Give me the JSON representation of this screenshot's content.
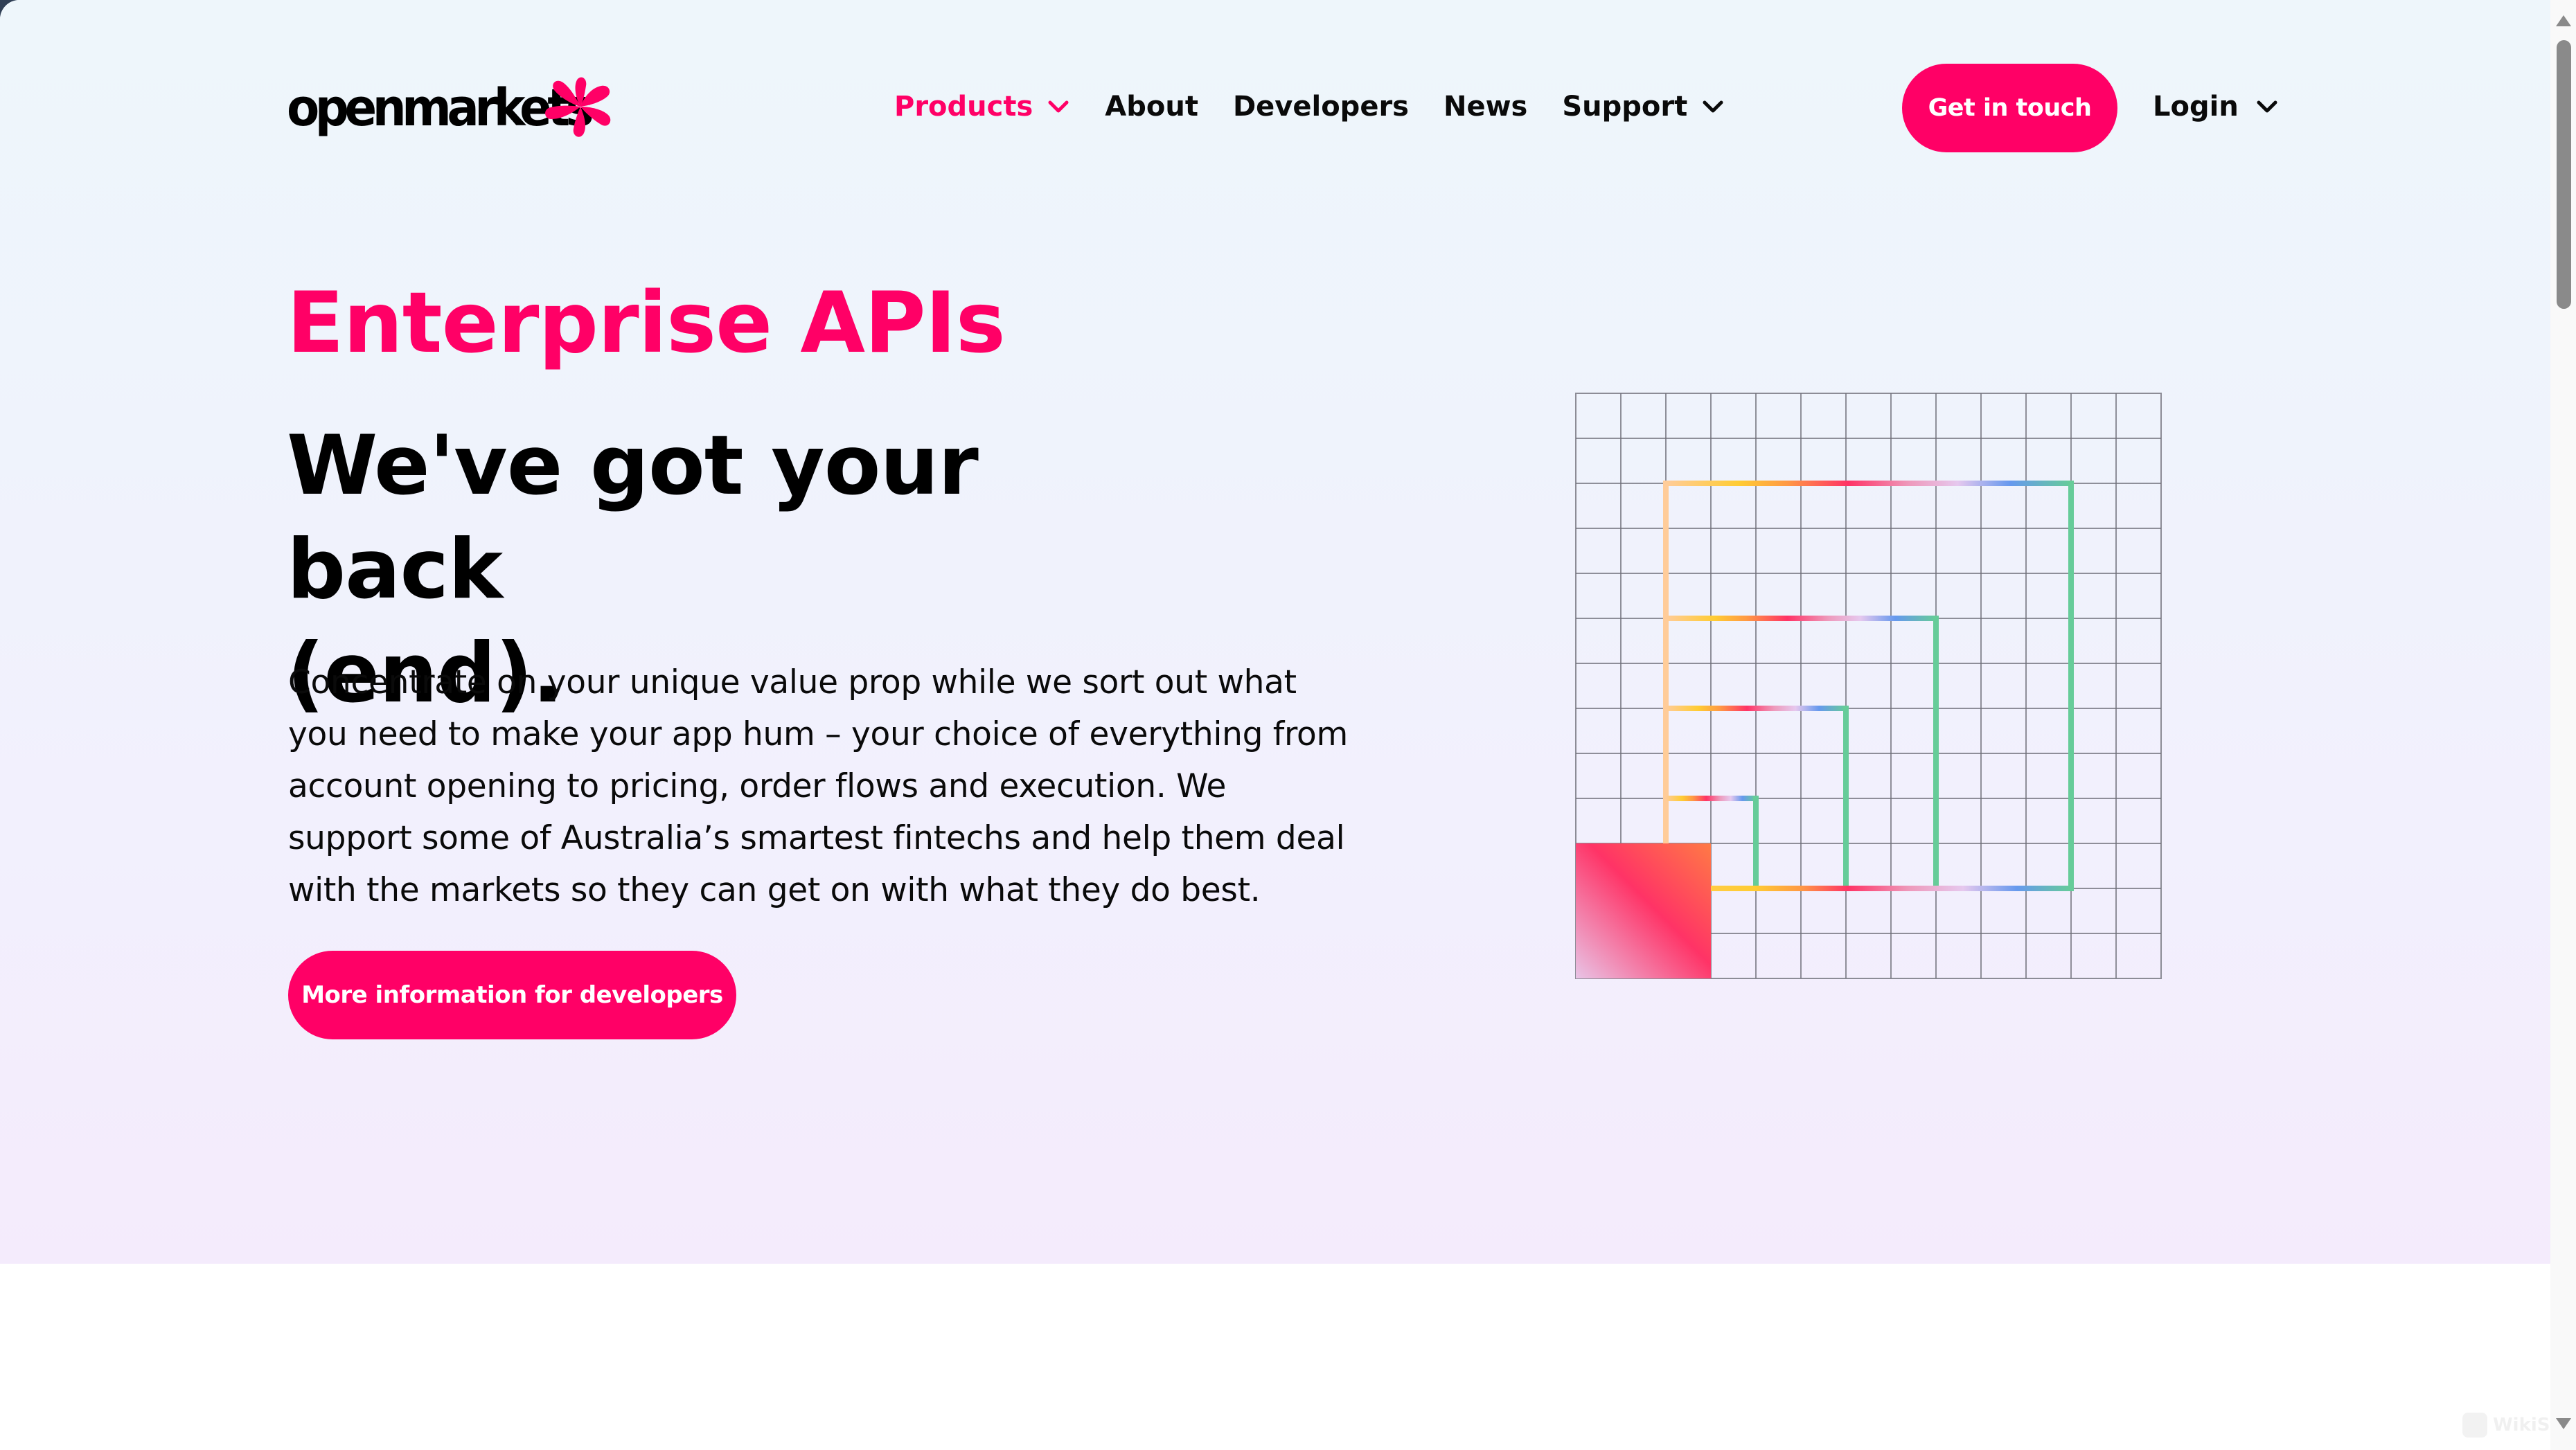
{
  "brand": {
    "name": "openmarkets",
    "accent_color": "#ff0066",
    "text_color": "#0a0a0a"
  },
  "nav": {
    "items": [
      {
        "label": "Products",
        "has_dropdown": true,
        "active": true
      },
      {
        "label": "About",
        "has_dropdown": false,
        "active": false
      },
      {
        "label": "Developers",
        "has_dropdown": false,
        "active": false
      },
      {
        "label": "News",
        "has_dropdown": false,
        "active": false
      },
      {
        "label": "Support",
        "has_dropdown": true,
        "active": false
      }
    ],
    "cta_label": "Get in touch",
    "login_label": "Login"
  },
  "hero": {
    "eyebrow": "Enterprise APIs",
    "headline_line1": "We've got your back",
    "headline_line2": "(end).",
    "body": "Concentrate on your unique value prop while we sort out what you need to make your app hum – your choice of everything from account opening to pricing, order flows and execution. We support some of Australia’s smartest fintechs and help them deal with the markets so they can get on with what they do best.",
    "cta_label": "More information for developers"
  },
  "illustration": {
    "grid_cells": 13,
    "gradient_colors": [
      "#ffcc99",
      "#ffcc33",
      "#ff9944",
      "#ff3366",
      "#ee99bb",
      "#e6c8ee",
      "#6699ee",
      "#66cc99"
    ],
    "square_colors": [
      "#e8c4e6",
      "#ff3366",
      "#ff7a45"
    ]
  },
  "watermark": {
    "text": "WikiStock"
  }
}
